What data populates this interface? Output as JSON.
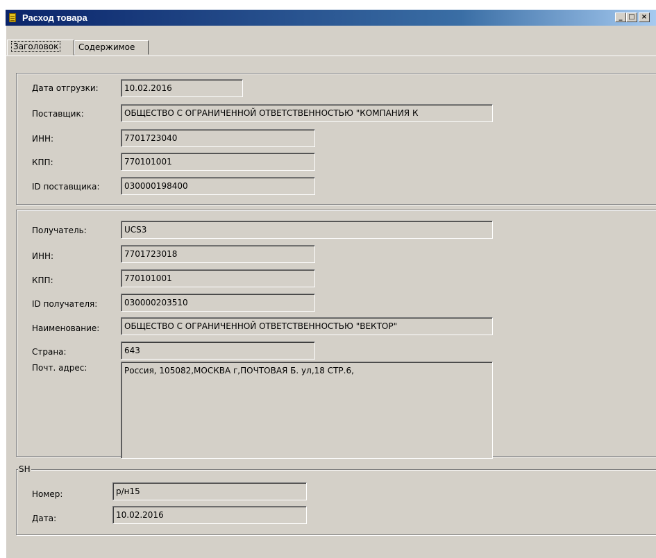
{
  "window": {
    "title": "Расход товара",
    "controls": {
      "minimize": "_",
      "maximize": "□",
      "close": "×"
    }
  },
  "tabs": [
    {
      "label": "Заголовок",
      "active": true
    },
    {
      "label": "Содержимое",
      "active": false
    }
  ],
  "supplier": {
    "date_label": "Дата отгрузки:",
    "date_value": "10.02.2016",
    "name_label": "Поставщик:",
    "name_value": "ОБЩЕСТВО С ОГРАНИЧЕННОЙ ОТВЕТСТВЕННОСТЬЮ \"КОМПАНИЯ К",
    "inn_label": "ИНН:",
    "inn_value": "7701723040",
    "kpp_label": "КПП:",
    "kpp_value": "770101001",
    "id_label": "ID поставщика:",
    "id_value": "030000198400"
  },
  "recipient": {
    "recipient_label": "Получатель:",
    "recipient_value": "UCS3",
    "inn_label": "ИНН:",
    "inn_value": "7701723018",
    "kpp_label": "КПП:",
    "kpp_value": "770101001",
    "id_label": "ID получателя:",
    "id_value": "030000203510",
    "name_label": "Наименование:",
    "name_value": "ОБЩЕСТВО С ОГРАНИЧЕННОЙ ОТВЕТСТВЕННОСТЬЮ \"ВЕКТОР\"",
    "country_label": "Страна:",
    "country_value": "643",
    "address_label": "Почт. адрес:",
    "address_value": "Россия, 105082,МОСКВА г,ПОЧТОВАЯ Б. ул,18 СТР.6,"
  },
  "sh": {
    "legend": "SH",
    "number_label": "Номер:",
    "number_value": "р/н15",
    "date_label": "Дата:",
    "date_value": "10.02.2016"
  }
}
